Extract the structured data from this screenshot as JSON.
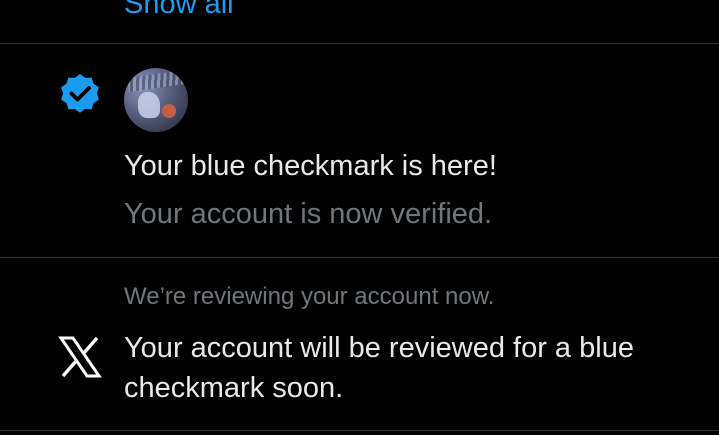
{
  "top": {
    "show_all_label": "Show all"
  },
  "notifications": [
    {
      "icon": "verified-badge-icon",
      "avatar": "user-avatar",
      "title": "Your blue checkmark is here!",
      "subtitle": "Your account is now verified."
    },
    {
      "icon": "x-logo-icon",
      "header": "We’re reviewing your account now.",
      "body": "Your account will be reviewed for a blue checkmark soon."
    }
  ],
  "colors": {
    "background": "#000000",
    "accent": "#1d9bf0",
    "text_primary": "#e7e9ea",
    "text_secondary": "#71767b",
    "divider": "#2f3336"
  }
}
